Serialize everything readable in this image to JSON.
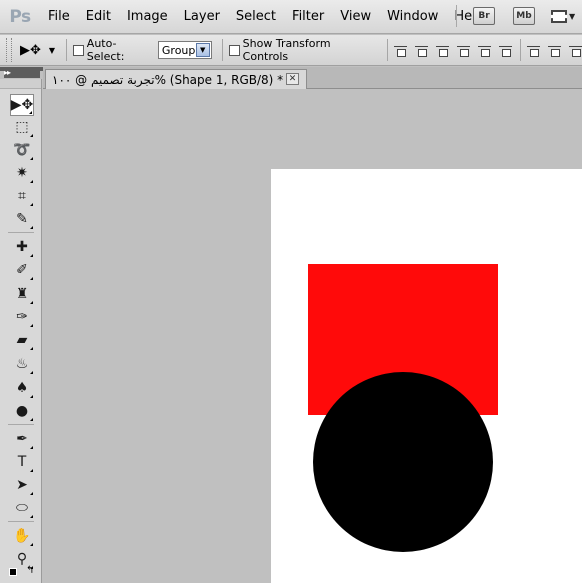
{
  "app": {
    "logo_text": "Ps",
    "menu": [
      "File",
      "Edit",
      "Image",
      "Layer",
      "Select",
      "Filter",
      "View",
      "Window",
      "Help"
    ],
    "bridge_label": "Br",
    "minibridge_label": "Mb"
  },
  "options": {
    "auto_select_label": "Auto-Select:",
    "auto_select_checked": false,
    "auto_select_value": "Group",
    "show_transform_label": "Show Transform Controls",
    "show_transform_checked": false
  },
  "document": {
    "tab_title": "تجربة تصميم @ ١٠٠% (Shape 1, RGB/8) *",
    "close_glyph": "✕",
    "shapes": [
      {
        "name": "red-rectangle",
        "color": "#ff0a0a"
      },
      {
        "name": "black-circle",
        "color": "#000000"
      }
    ]
  },
  "tools": [
    {
      "name": "move-tool-icon",
      "glyph": "▶✥",
      "active": true
    },
    {
      "name": "marquee-tool-icon",
      "glyph": "⬚"
    },
    {
      "name": "lasso-tool-icon",
      "glyph": "➰"
    },
    {
      "name": "quick-selection-tool-icon",
      "glyph": "✷"
    },
    {
      "name": "crop-tool-icon",
      "glyph": "⌗"
    },
    {
      "name": "eyedropper-tool-icon",
      "glyph": "✎"
    },
    {
      "name": "healing-brush-tool-icon",
      "glyph": "✚"
    },
    {
      "name": "brush-tool-icon",
      "glyph": "✐"
    },
    {
      "name": "clone-stamp-tool-icon",
      "glyph": "♜"
    },
    {
      "name": "history-brush-tool-icon",
      "glyph": "✑"
    },
    {
      "name": "eraser-tool-icon",
      "glyph": "▰"
    },
    {
      "name": "paint-bucket-tool-icon",
      "glyph": "♨"
    },
    {
      "name": "blur-tool-icon",
      "glyph": "♠"
    },
    {
      "name": "dodge-tool-icon",
      "glyph": "●"
    },
    {
      "name": "pen-tool-icon",
      "glyph": "✒"
    },
    {
      "name": "type-tool-icon",
      "glyph": "T"
    },
    {
      "name": "path-selection-tool-icon",
      "glyph": "➤"
    },
    {
      "name": "ellipse-tool-icon",
      "glyph": "⬭"
    },
    {
      "name": "hand-tool-icon",
      "glyph": "✋"
    },
    {
      "name": "zoom-tool-icon",
      "glyph": "⚲"
    }
  ]
}
